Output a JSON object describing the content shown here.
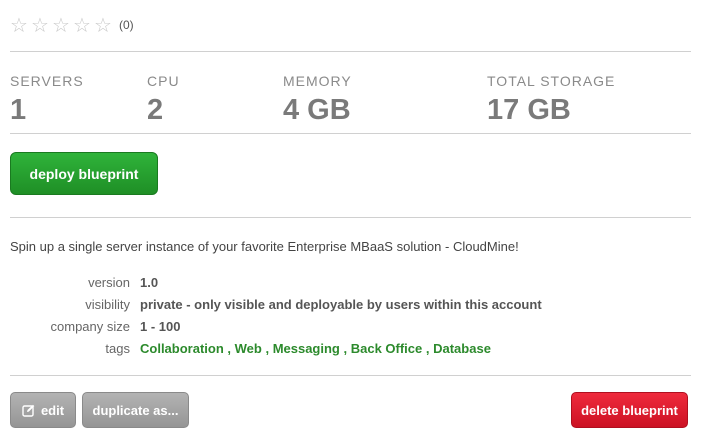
{
  "rating": {
    "stars": [
      "☆",
      "☆",
      "☆",
      "☆",
      "☆"
    ],
    "count": "(0)"
  },
  "stats": {
    "servers": {
      "label": "SERVERS",
      "value": "1"
    },
    "cpu": {
      "label": "CPU",
      "value": "2"
    },
    "memory": {
      "label": "MEMORY",
      "value": "4 GB"
    },
    "storage": {
      "label": "TOTAL STORAGE",
      "value": "17 GB"
    }
  },
  "actions": {
    "deploy_label": "deploy blueprint",
    "edit_label": "edit",
    "duplicate_label": "duplicate as...",
    "delete_label": "delete blueprint"
  },
  "description": "Spin up a single server instance of your favorite Enterprise MBaaS solution - CloudMine!",
  "meta": {
    "version": {
      "key": "version",
      "value": "1.0"
    },
    "visibility": {
      "key": "visibility",
      "value": "private - only visible and deployable by users within this account"
    },
    "company_size": {
      "key": "company size",
      "value": "1 - 100"
    },
    "tags": {
      "key": "tags",
      "items": [
        "Collaboration",
        "Web",
        "Messaging",
        "Back Office",
        "Database"
      ],
      "separator": " , "
    }
  },
  "colors": {
    "deploy_green": "#1f8f26",
    "delete_red": "#cc1224",
    "tag_green": "#2c8a2c",
    "stat_gray": "#7a7a7a"
  }
}
